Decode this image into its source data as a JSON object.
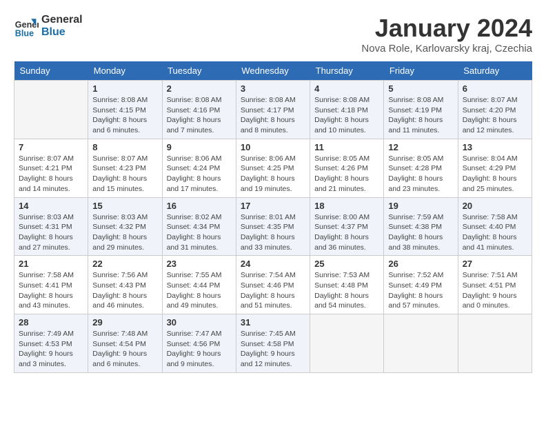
{
  "header": {
    "logo_line1": "General",
    "logo_line2": "Blue",
    "month": "January 2024",
    "location": "Nova Role, Karlovarsky kraj, Czechia"
  },
  "weekdays": [
    "Sunday",
    "Monday",
    "Tuesday",
    "Wednesday",
    "Thursday",
    "Friday",
    "Saturday"
  ],
  "weeks": [
    [
      {
        "day": "",
        "text": ""
      },
      {
        "day": "1",
        "text": "Sunrise: 8:08 AM\nSunset: 4:15 PM\nDaylight: 8 hours\nand 6 minutes."
      },
      {
        "day": "2",
        "text": "Sunrise: 8:08 AM\nSunset: 4:16 PM\nDaylight: 8 hours\nand 7 minutes."
      },
      {
        "day": "3",
        "text": "Sunrise: 8:08 AM\nSunset: 4:17 PM\nDaylight: 8 hours\nand 8 minutes."
      },
      {
        "day": "4",
        "text": "Sunrise: 8:08 AM\nSunset: 4:18 PM\nDaylight: 8 hours\nand 10 minutes."
      },
      {
        "day": "5",
        "text": "Sunrise: 8:08 AM\nSunset: 4:19 PM\nDaylight: 8 hours\nand 11 minutes."
      },
      {
        "day": "6",
        "text": "Sunrise: 8:07 AM\nSunset: 4:20 PM\nDaylight: 8 hours\nand 12 minutes."
      }
    ],
    [
      {
        "day": "7",
        "text": "Sunrise: 8:07 AM\nSunset: 4:21 PM\nDaylight: 8 hours\nand 14 minutes."
      },
      {
        "day": "8",
        "text": "Sunrise: 8:07 AM\nSunset: 4:23 PM\nDaylight: 8 hours\nand 15 minutes."
      },
      {
        "day": "9",
        "text": "Sunrise: 8:06 AM\nSunset: 4:24 PM\nDaylight: 8 hours\nand 17 minutes."
      },
      {
        "day": "10",
        "text": "Sunrise: 8:06 AM\nSunset: 4:25 PM\nDaylight: 8 hours\nand 19 minutes."
      },
      {
        "day": "11",
        "text": "Sunrise: 8:05 AM\nSunset: 4:26 PM\nDaylight: 8 hours\nand 21 minutes."
      },
      {
        "day": "12",
        "text": "Sunrise: 8:05 AM\nSunset: 4:28 PM\nDaylight: 8 hours\nand 23 minutes."
      },
      {
        "day": "13",
        "text": "Sunrise: 8:04 AM\nSunset: 4:29 PM\nDaylight: 8 hours\nand 25 minutes."
      }
    ],
    [
      {
        "day": "14",
        "text": "Sunrise: 8:03 AM\nSunset: 4:31 PM\nDaylight: 8 hours\nand 27 minutes."
      },
      {
        "day": "15",
        "text": "Sunrise: 8:03 AM\nSunset: 4:32 PM\nDaylight: 8 hours\nand 29 minutes."
      },
      {
        "day": "16",
        "text": "Sunrise: 8:02 AM\nSunset: 4:34 PM\nDaylight: 8 hours\nand 31 minutes."
      },
      {
        "day": "17",
        "text": "Sunrise: 8:01 AM\nSunset: 4:35 PM\nDaylight: 8 hours\nand 33 minutes."
      },
      {
        "day": "18",
        "text": "Sunrise: 8:00 AM\nSunset: 4:37 PM\nDaylight: 8 hours\nand 36 minutes."
      },
      {
        "day": "19",
        "text": "Sunrise: 7:59 AM\nSunset: 4:38 PM\nDaylight: 8 hours\nand 38 minutes."
      },
      {
        "day": "20",
        "text": "Sunrise: 7:58 AM\nSunset: 4:40 PM\nDaylight: 8 hours\nand 41 minutes."
      }
    ],
    [
      {
        "day": "21",
        "text": "Sunrise: 7:58 AM\nSunset: 4:41 PM\nDaylight: 8 hours\nand 43 minutes."
      },
      {
        "day": "22",
        "text": "Sunrise: 7:56 AM\nSunset: 4:43 PM\nDaylight: 8 hours\nand 46 minutes."
      },
      {
        "day": "23",
        "text": "Sunrise: 7:55 AM\nSunset: 4:44 PM\nDaylight: 8 hours\nand 49 minutes."
      },
      {
        "day": "24",
        "text": "Sunrise: 7:54 AM\nSunset: 4:46 PM\nDaylight: 8 hours\nand 51 minutes."
      },
      {
        "day": "25",
        "text": "Sunrise: 7:53 AM\nSunset: 4:48 PM\nDaylight: 8 hours\nand 54 minutes."
      },
      {
        "day": "26",
        "text": "Sunrise: 7:52 AM\nSunset: 4:49 PM\nDaylight: 8 hours\nand 57 minutes."
      },
      {
        "day": "27",
        "text": "Sunrise: 7:51 AM\nSunset: 4:51 PM\nDaylight: 9 hours\nand 0 minutes."
      }
    ],
    [
      {
        "day": "28",
        "text": "Sunrise: 7:49 AM\nSunset: 4:53 PM\nDaylight: 9 hours\nand 3 minutes."
      },
      {
        "day": "29",
        "text": "Sunrise: 7:48 AM\nSunset: 4:54 PM\nDaylight: 9 hours\nand 6 minutes."
      },
      {
        "day": "30",
        "text": "Sunrise: 7:47 AM\nSunset: 4:56 PM\nDaylight: 9 hours\nand 9 minutes."
      },
      {
        "day": "31",
        "text": "Sunrise: 7:45 AM\nSunset: 4:58 PM\nDaylight: 9 hours\nand 12 minutes."
      },
      {
        "day": "",
        "text": ""
      },
      {
        "day": "",
        "text": ""
      },
      {
        "day": "",
        "text": ""
      }
    ]
  ]
}
